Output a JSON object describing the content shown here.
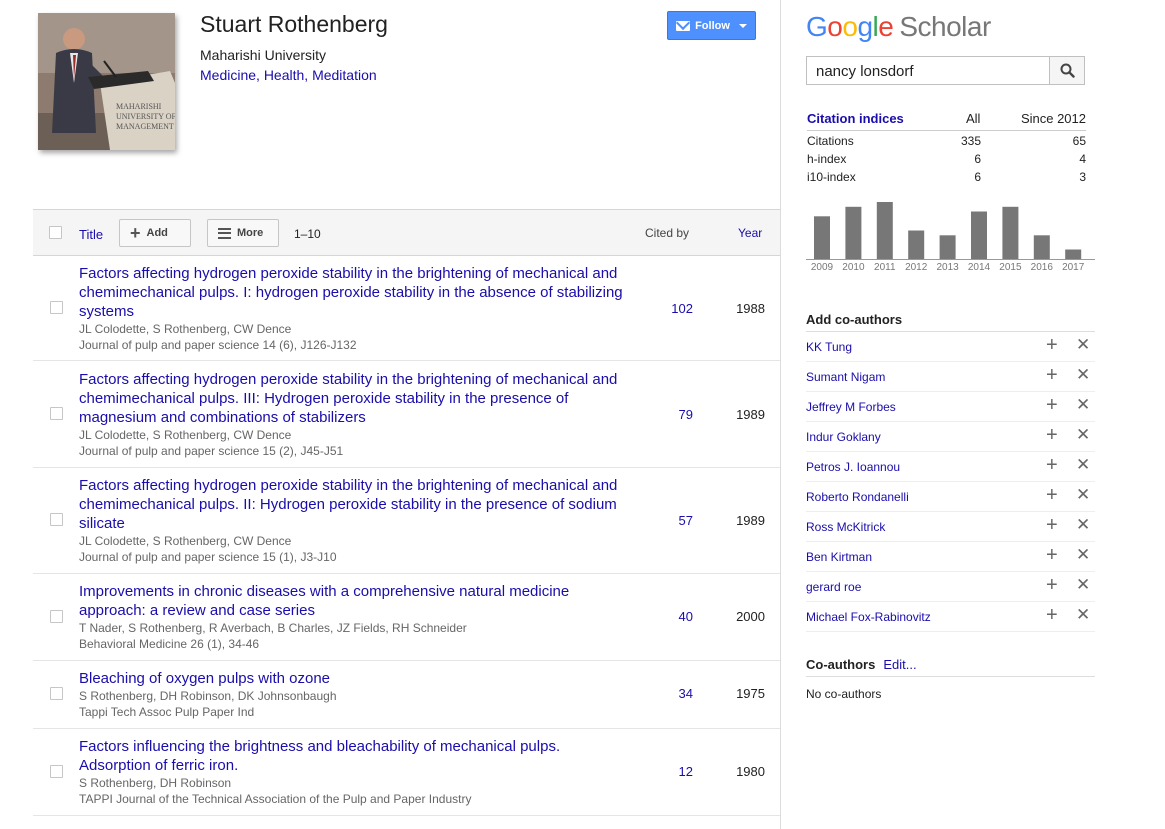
{
  "profile": {
    "name": "Stuart Rothenberg",
    "affiliation": "Maharishi University",
    "interests": [
      "Medicine",
      "Health",
      "Meditation"
    ],
    "interest_separator": ", ",
    "photo_sign_lines": [
      "MAHARISHI",
      "UNIVERSITY OF",
      "MANAGEMENT"
    ],
    "follow_label": "Follow"
  },
  "toolbar": {
    "title_label": "Title",
    "add_label": "Add",
    "more_label": "More",
    "range": "1–10",
    "cited_by_label": "Cited by",
    "year_label": "Year"
  },
  "articles": [
    {
      "title": "Factors affecting hydrogen peroxide stability in the brightening of mechanical and chemimechanical pulps. I: hydrogen peroxide stability in the absence of stabilizing systems",
      "authors": "JL Colodette, S Rothenberg, CW Dence",
      "venue": "Journal of pulp and paper science 14 (6), J126-J132",
      "cited_by": "102",
      "year": "1988"
    },
    {
      "title": "Factors affecting hydrogen peroxide stability in the brightening of mechanical and chemimechanical pulps. III: Hydrogen peroxide stability in the presence of magnesium and combinations of stabilizers",
      "authors": "JL Colodette, S Rothenberg, CW Dence",
      "venue": "Journal of pulp and paper science 15 (2), J45-J51",
      "cited_by": "79",
      "year": "1989"
    },
    {
      "title": "Factors affecting hydrogen peroxide stability in the brightening of mechanical and chemimechanical pulps. II: Hydrogen peroxide stability in the presence of sodium silicate",
      "authors": "JL Colodette, S Rothenberg, CW Dence",
      "venue": "Journal of pulp and paper science 15 (1), J3-J10",
      "cited_by": "57",
      "year": "1989"
    },
    {
      "title": "Improvements in chronic diseases with a comprehensive natural medicine approach: a review and case series",
      "authors": "T Nader, S Rothenberg, R Averbach, B Charles, JZ Fields, RH Schneider",
      "venue": "Behavioral Medicine 26 (1), 34-46",
      "cited_by": "40",
      "year": "2000"
    },
    {
      "title": "Bleaching of oxygen pulps with ozone",
      "authors": "S Rothenberg, DH Robinson, DK Johnsonbaugh",
      "venue": "Tappi Tech Assoc Pulp Paper Ind",
      "cited_by": "34",
      "year": "1975"
    },
    {
      "title": "Factors influencing the brightness and bleachability of mechanical pulps. Adsorption of ferric iron.",
      "authors": "S Rothenberg, DH Robinson",
      "venue": "TAPPI Journal of the Technical Association of the Pulp and Paper Industry",
      "cited_by": "12",
      "year": "1980"
    }
  ],
  "sidebar": {
    "logo_google": [
      "G",
      "o",
      "o",
      "g",
      "l",
      "e"
    ],
    "logo_colors": [
      "#4285F4",
      "#EA4335",
      "#FBBC05",
      "#4285F4",
      "#34A853",
      "#EA4335"
    ],
    "logo_scholar": "Scholar",
    "search_value": "nancy lonsdorf",
    "citation_indices": {
      "header": "Citation indices",
      "col_all": "All",
      "col_since": "Since 2012",
      "rows": [
        {
          "label": "Citations",
          "all": "335",
          "since": "65"
        },
        {
          "label": "h-index",
          "all": "6",
          "since": "4"
        },
        {
          "label": "i10-index",
          "all": "6",
          "since": "3"
        }
      ]
    },
    "add_coauthors_label": "Add co-authors",
    "suggested_coauthors": [
      "KK Tung",
      "Sumant Nigam",
      "Jeffrey M Forbes",
      "Indur Goklany",
      "Petros J. Ioannou",
      "Roberto Rondanelli",
      "Ross McKitrick",
      "Ben Kirtman",
      "gerard roe",
      "Michael Fox-Rabinovitz"
    ],
    "coauthors_label": "Co-authors",
    "coauthors_edit": "Edit...",
    "no_coauthors": "No co-authors"
  },
  "chart_data": {
    "type": "bar",
    "categories": [
      "2009",
      "2010",
      "2011",
      "2012",
      "2013",
      "2014",
      "2015",
      "2016",
      "2017"
    ],
    "values": [
      9,
      11,
      12,
      6,
      5,
      10,
      11,
      5,
      2
    ],
    "bar_color": "#777777"
  }
}
